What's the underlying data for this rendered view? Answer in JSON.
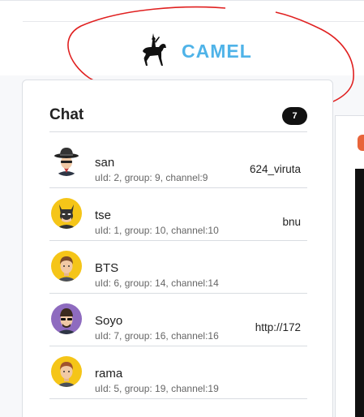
{
  "header": {
    "app_name": "CAMEL",
    "logo_icon": "horse-rider-icon",
    "brand_color": "#4fb3e8"
  },
  "chat_panel": {
    "title": "Chat",
    "badge": "7",
    "items": [
      {
        "name": "san",
        "meta": "uId: 2, group: 9, channel:9",
        "value": "624_viruta",
        "avatar": "spy-hat-avatar"
      },
      {
        "name": "tse",
        "meta": "uId: 1, group: 10, channel:10",
        "value": "bnu",
        "avatar": "batman-avatar"
      },
      {
        "name": "BTS",
        "meta": "uId: 6, group: 14, channel:14",
        "value": "",
        "avatar": "man-avatar"
      },
      {
        "name": "Soyo",
        "meta": "uId: 7, group: 16, channel:16",
        "value": "http://172",
        "avatar": "sunglasses-avatar"
      },
      {
        "name": "rama",
        "meta": "uId: 5, group: 19, channel:19",
        "value": "",
        "avatar": "man-avatar"
      }
    ]
  },
  "colors": {
    "accent_orange": "#e8643a",
    "annotation_red": "#e02020"
  }
}
